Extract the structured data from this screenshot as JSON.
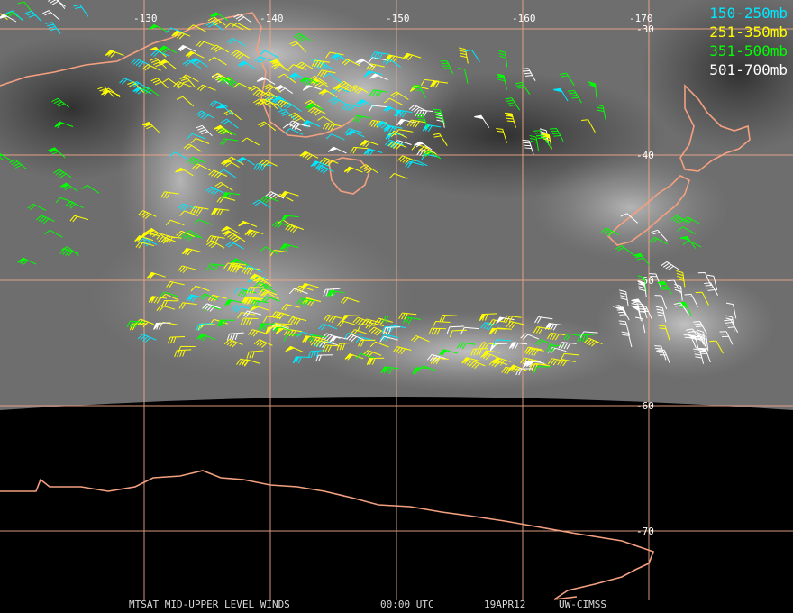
{
  "legend": [
    {
      "label": "150-250mb",
      "color": "#00e8ff"
    },
    {
      "label": "251-350mb",
      "color": "#ffff00"
    },
    {
      "label": "351-500mb",
      "color": "#00ff00"
    },
    {
      "label": "501-700mb",
      "color": "#ffffff"
    }
  ],
  "longitude_labels": [
    "-130",
    "-140",
    "-150",
    "-160",
    "-170"
  ],
  "latitude_labels": [
    "-30",
    "-40",
    "-50",
    "-60",
    "-70"
  ],
  "footer": {
    "product": "MTSAT MID-UPPER LEVEL WINDS",
    "time": "00:00 UTC",
    "date": "19APR12",
    "credit": "UW-CIMSS"
  },
  "colors": {
    "grid": "#f0a888",
    "coastline": "#f4a080",
    "background_space": "#000000",
    "cloud_gray": "#707070"
  },
  "icons": {
    "wind_barb": "wind-barb-icon"
  }
}
